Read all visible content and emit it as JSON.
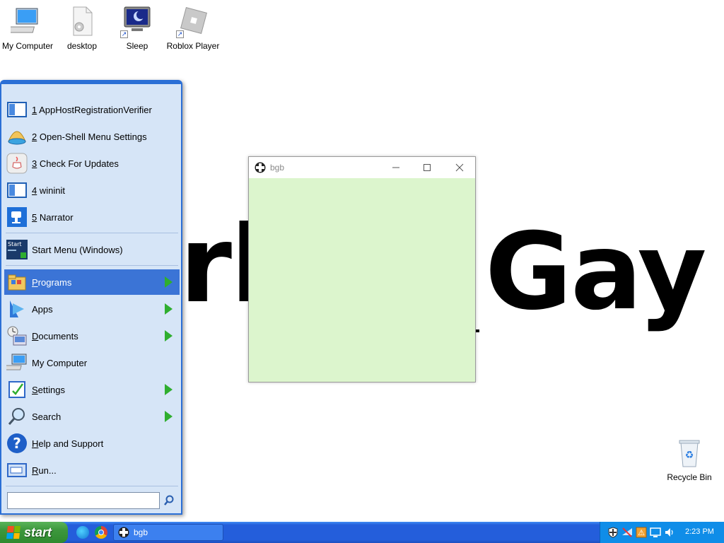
{
  "desktop": {
    "background_text_left": "rk",
    "background_text_right": "Gay",
    "icons": [
      {
        "label": "My Computer",
        "icon": "computer-icon"
      },
      {
        "label": "desktop",
        "icon": "settings-file-icon"
      },
      {
        "label": "Sleep",
        "icon": "sleep-monitor-icon"
      },
      {
        "label": "Roblox Player",
        "icon": "roblox-icon"
      }
    ],
    "recycle_bin": {
      "label": "Recycle Bin",
      "icon": "recycle-bin-icon"
    }
  },
  "start_menu": {
    "recent": [
      {
        "key": "1",
        "label": "AppHostRegistrationVerifier",
        "icon": "app-window-icon"
      },
      {
        "key": "2",
        "label": "Open-Shell Menu Settings",
        "icon": "shell-icon"
      },
      {
        "key": "3",
        "label": "Check For Updates",
        "icon": "java-icon"
      },
      {
        "key": "4",
        "label": "wininit",
        "icon": "app-window-icon"
      },
      {
        "key": "5",
        "label": "Narrator",
        "icon": "narrator-icon"
      }
    ],
    "pinned": {
      "label": "Start Menu (Windows)",
      "icon": "start-menu-icon"
    },
    "items": [
      {
        "label": "Programs",
        "ul": "P",
        "rest": "rograms",
        "submenu": true,
        "active": true,
        "icon": "programs-folder-icon"
      },
      {
        "label": "Apps",
        "ul": "",
        "rest": "Apps",
        "submenu": true,
        "active": false,
        "icon": "apps-icon"
      },
      {
        "label": "Documents",
        "ul": "D",
        "rest": "ocuments",
        "submenu": true,
        "active": false,
        "icon": "documents-icon"
      },
      {
        "label": "My Computer",
        "ul": "",
        "rest": "My Computer",
        "submenu": false,
        "active": false,
        "icon": "computer-icon"
      },
      {
        "label": "Settings",
        "ul": "S",
        "rest": "ettings",
        "submenu": true,
        "active": false,
        "icon": "settings-icon"
      },
      {
        "label": "Search",
        "ul": "",
        "rest": "Search",
        "submenu": true,
        "active": false,
        "icon": "search-icon"
      },
      {
        "label": "Help and Support",
        "ul": "H",
        "rest": "elp and Support",
        "submenu": false,
        "active": false,
        "icon": "help-icon"
      },
      {
        "label": "Run...",
        "ul": "R",
        "rest": "un...",
        "submenu": false,
        "active": false,
        "icon": "run-icon"
      }
    ],
    "search": {
      "value": "",
      "placeholder": ""
    }
  },
  "window": {
    "title": "bgb",
    "client_color": "#dcf5cd"
  },
  "taskbar": {
    "start_label": "start",
    "task_button": "bgb",
    "clock": "2:23 PM"
  },
  "colors": {
    "taskbar_blue": "#245edb",
    "start_green": "#3c973c",
    "menu_bg": "#d6e5f7",
    "menu_highlight": "#3b74d6",
    "submenu_arrow": "#2fae2f"
  }
}
